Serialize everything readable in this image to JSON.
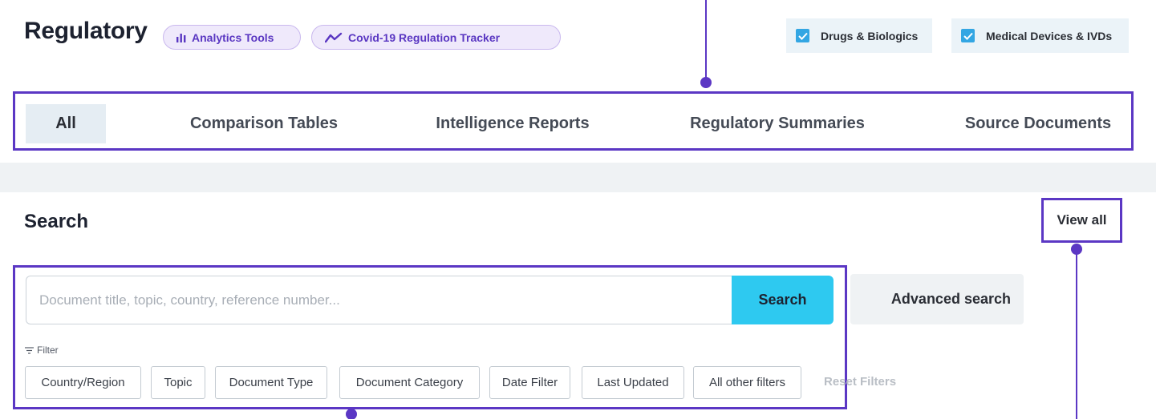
{
  "header": {
    "title": "Regulatory",
    "pills": [
      {
        "label": "Analytics Tools",
        "icon": "bar-chart-icon"
      },
      {
        "label": "Covid-19 Regulation Tracker",
        "icon": "trend-line-icon"
      }
    ],
    "checkboxes": [
      {
        "label": "Drugs & Biologics",
        "checked": true
      },
      {
        "label": "Medical Devices & IVDs",
        "checked": true
      }
    ]
  },
  "tabs": [
    {
      "label": "All",
      "active": true
    },
    {
      "label": "Comparison Tables"
    },
    {
      "label": "Intelligence Reports"
    },
    {
      "label": "Regulatory Summaries"
    },
    {
      "label": "Source Documents"
    }
  ],
  "search": {
    "title": "Search",
    "view_all": "View all",
    "placeholder": "Document title, topic, country, reference number...",
    "button": "Search",
    "advanced": "Advanced search",
    "filter_label": "Filter",
    "chips": [
      "Country/Region",
      "Topic",
      "Document Type",
      "Document Category",
      "Date Filter",
      "Last Updated",
      "All other filters"
    ],
    "reset": "Reset Filters"
  },
  "colors": {
    "accent": "#5b37c4",
    "search_button": "#2ec9f0",
    "checkbox": "#33a6e3",
    "pill_bg": "#efe9fb"
  }
}
